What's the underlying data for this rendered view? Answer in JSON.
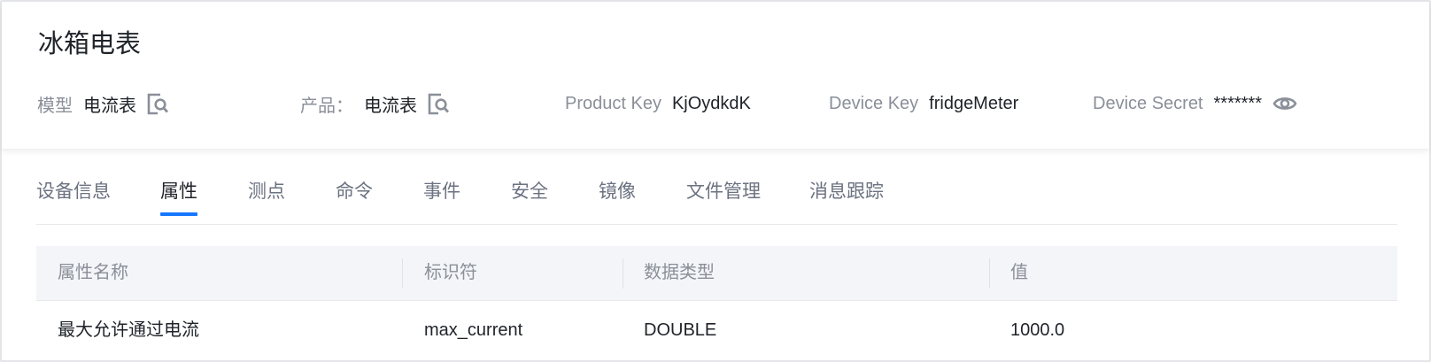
{
  "device": {
    "title": "冰箱电表"
  },
  "meta": {
    "model_label": "模型",
    "model_value": "电流表",
    "product_label": "产品：",
    "product_value": "电流表",
    "product_key_label": "Product Key",
    "product_key_value": "KjOydkdK",
    "device_key_label": "Device Key",
    "device_key_value": "fridgeMeter",
    "device_secret_label": "Device Secret",
    "device_secret_value": "*******"
  },
  "icons": {
    "model_view": "search-doc-icon",
    "product_view": "search-doc-icon",
    "secret_toggle": "eye-icon"
  },
  "tabs": [
    {
      "label": "设备信息",
      "active": false
    },
    {
      "label": "属性",
      "active": true
    },
    {
      "label": "测点",
      "active": false
    },
    {
      "label": "命令",
      "active": false
    },
    {
      "label": "事件",
      "active": false
    },
    {
      "label": "安全",
      "active": false
    },
    {
      "label": "镜像",
      "active": false
    },
    {
      "label": "文件管理",
      "active": false
    },
    {
      "label": "消息跟踪",
      "active": false
    }
  ],
  "table": {
    "headers": [
      "属性名称",
      "标识符",
      "数据类型",
      "值"
    ],
    "rows": [
      [
        "最大允许通过电流",
        "max_current",
        "DOUBLE",
        "1000.0"
      ]
    ]
  },
  "colors": {
    "accent": "#1677ff",
    "label": "#8a8f99",
    "text": "#1f2329",
    "header_bg": "#f4f5f8"
  }
}
